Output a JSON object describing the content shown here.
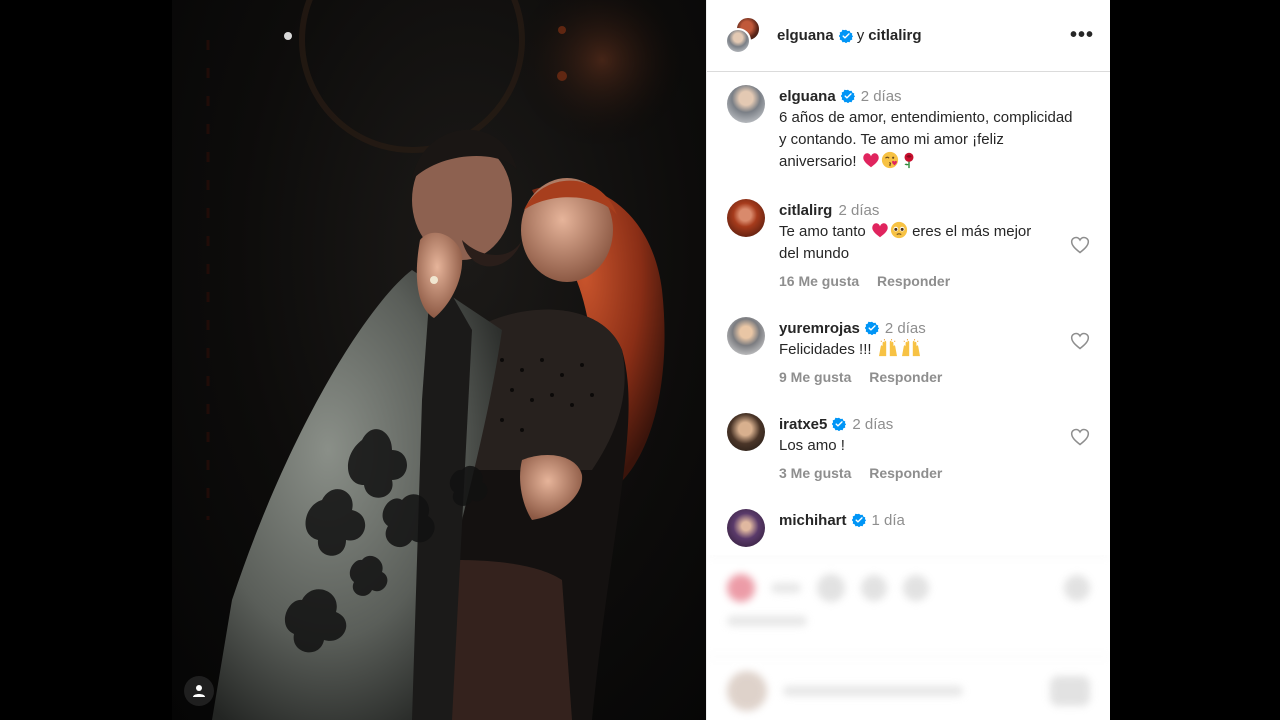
{
  "header": {
    "author": "elguana",
    "conjunction": "y",
    "collaborator": "citlalirg",
    "more_label": "•••"
  },
  "caption": {
    "username": "elguana",
    "time": "2 días",
    "text": "6 años de amor, entendimiento, complicidad y contando. Te amo mi amor ¡feliz aniversario!",
    "emojis": [
      "red-heart",
      "kiss-face",
      "rose"
    ]
  },
  "comments": [
    {
      "username": "citlalirg",
      "verified": false,
      "time": "2 días",
      "text_before": "Te amo tanto",
      "text_after": "eres el más mejor del mundo",
      "likes": "16 Me gusta",
      "reply": "Responder"
    },
    {
      "username": "yuremrojas",
      "verified": true,
      "time": "2 días",
      "text": "Felicidades !!!",
      "likes": "9 Me gusta",
      "reply": "Responder"
    },
    {
      "username": "iratxe5",
      "verified": true,
      "time": "2 días",
      "text": "Los amo !",
      "likes": "3 Me gusta",
      "reply": "Responder"
    },
    {
      "username": "michihart",
      "verified": true,
      "time": "1 día",
      "text": ""
    }
  ],
  "icons": {
    "verified": "verified-badge-icon",
    "heart": "heart-outline-icon",
    "tag": "user-tag-icon",
    "more": "more-options-icon"
  },
  "colors": {
    "verified_blue": "#0095f6",
    "text": "#262626",
    "muted": "#8e8e8e",
    "heart_red": "#e0245e"
  }
}
